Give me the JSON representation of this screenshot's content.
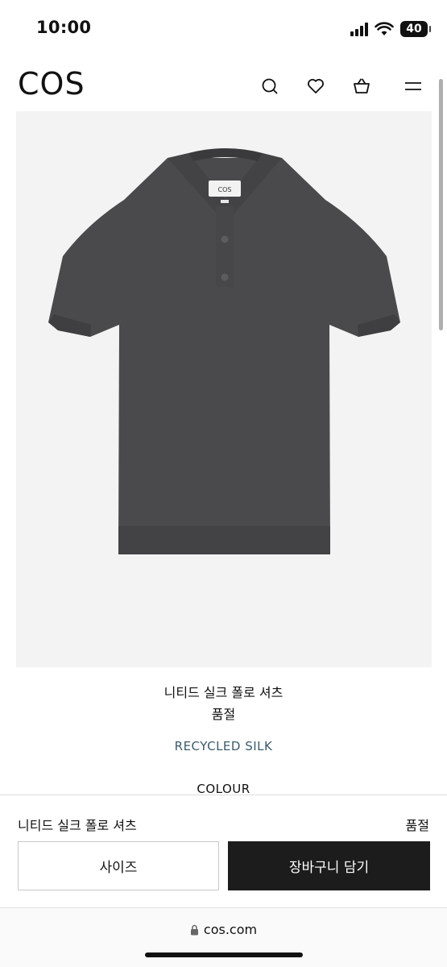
{
  "status_bar": {
    "time": "10:00",
    "battery": "40",
    "icons": [
      "signal-icon",
      "wifi-icon",
      "battery-icon"
    ]
  },
  "header": {
    "logo": "COS",
    "icons": [
      "search-icon",
      "heart-icon",
      "basket-icon",
      "menu-icon"
    ]
  },
  "product": {
    "image": "grey-knitted-polo-shirt",
    "title": "니티드 실크 폴로 셔츠",
    "status": "품절",
    "material": "RECYCLED SILK",
    "colour_label": "COLOUR"
  },
  "sticky_bar": {
    "name": "니티드 실크 폴로 셔츠",
    "status": "품절",
    "size_label": "사이즈",
    "cart_label": "장바구니 담기"
  },
  "browser": {
    "url": "cos.com",
    "icon": "lock-icon"
  },
  "colors": {
    "accent_material": "#3b5b6b",
    "cart_button": "#1c1c1c",
    "shirt": "#4a4a4c"
  }
}
